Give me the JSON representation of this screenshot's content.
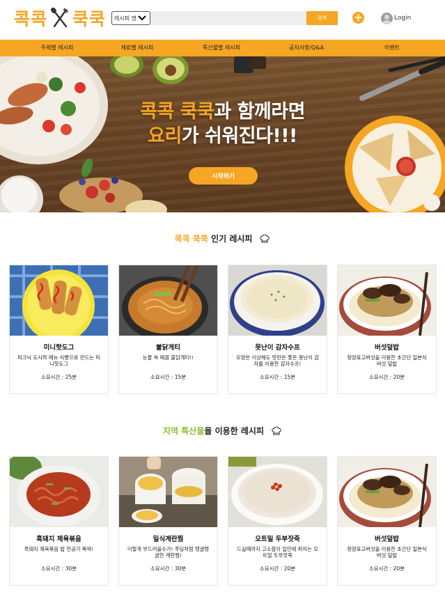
{
  "header": {
    "logo_left": "콕콕",
    "logo_right": "쿡쿡",
    "search_select_value": "레시피 명",
    "search_button": "검색",
    "plus_label": "+",
    "login_label": "Login"
  },
  "nav": {
    "items": [
      {
        "label": "주제별 레시피"
      },
      {
        "label": "재료별 레시피"
      },
      {
        "label": "특산물별 레시피"
      },
      {
        "label": "공지사항/Q&A"
      },
      {
        "label": "이벤트"
      }
    ]
  },
  "hero": {
    "line1_accent": "콕콕 쿡쿡",
    "line1_rest": "과 함께라면",
    "line2_accent": "요리",
    "line2_rest": "가 쉬워진다!!!",
    "button": "시작하기"
  },
  "popular": {
    "title_highlight": "콕콕 쿡쿡",
    "title_rest": " 인기 레시피",
    "cards": [
      {
        "name": "미니핫도그",
        "desc": "피크닉 도시락 메뉴 식빵으로 만드는 미니핫도그",
        "time": "소요시간 : 25분"
      },
      {
        "name": "불닭게티",
        "desc": "눈물 쏙 매콤 불닭게티!!",
        "time": "소요시간 : 15분"
      },
      {
        "name": "못난이 감자수프",
        "desc": "모양은 이상해도 맛만은 좋은 못난이 감자를 이용한 감자수프!",
        "time": "소요시간 : 15분"
      },
      {
        "name": "버섯덮밥",
        "desc": "청양표고버섯을 이용한 초간단 일본식 버섯 덮밥",
        "time": "소요시간 : 20분"
      }
    ]
  },
  "regional": {
    "title_highlight": "지역 특산물",
    "title_rest": "을 이용한 레시피",
    "cards": [
      {
        "name": "흑돼지 제육볶음",
        "desc": "흑돼지 제육볶음 밥 한공기 뚝딱!",
        "time": "소요시간 : 30분"
      },
      {
        "name": "일식계란찜",
        "desc": "이렇게 부드러울수가! 푸딩처럼 탱글탱글한 계란찜!",
        "time": "소요시간 : 30분"
      },
      {
        "name": "오트밀 두부잣죽",
        "desc": "드실때까지 고소함이 입안에 퍼지는 오트밀 두부잣죽",
        "time": "소요시간 : 20분"
      },
      {
        "name": "버섯덮밥",
        "desc": "청양표고버섯을 이용한 초간단 일본식 버섯 덮밥",
        "time": "소요시간 : 20분"
      }
    ]
  },
  "colors": {
    "brand_orange": "#f5a623",
    "accent_green": "#8dbf2a"
  }
}
